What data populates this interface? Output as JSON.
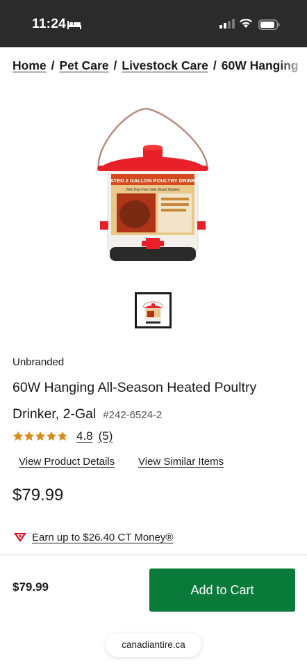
{
  "status_bar": {
    "time": "11:24"
  },
  "breadcrumb": {
    "items": [
      "Home",
      "Pet Care",
      "Livestock Care"
    ],
    "current": "60W Hanging"
  },
  "product": {
    "brand": "Unbranded",
    "title": "60W Hanging All-Season Heated Poultry Drinker, 2-Gal",
    "sku": "#242-6524-2",
    "rating": "4.8",
    "rating_count": "(5)",
    "stars_filled": 4.8,
    "price": "$79.99",
    "package_text": "HEATED 2 GALLON POULTRY DRINKER",
    "package_subtext": "With Drip-Free Side Mount Nipples"
  },
  "links": {
    "details": "View Product Details",
    "similar": "View Similar Items"
  },
  "ct_money": {
    "label": "Earn up to $26.40 CT Money®"
  },
  "bottom_bar": {
    "price": "$79.99",
    "add_to_cart_label": "Add to Cart"
  },
  "url": "canadiantire.ca",
  "colors": {
    "accent_green": "#0a7a3a",
    "star_gold": "#d98a1a",
    "ct_red": "#d0102a",
    "status_bar_bg": "#2b2b2b"
  }
}
